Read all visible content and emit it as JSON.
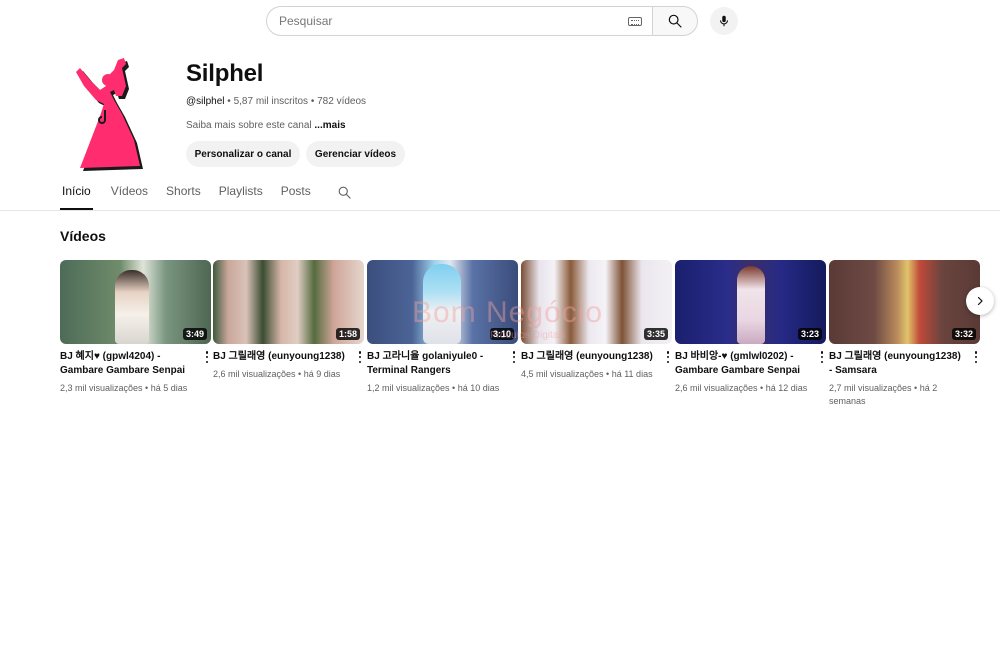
{
  "search": {
    "placeholder": "Pesquisar"
  },
  "channel": {
    "name": "Silphel",
    "handle": "@silphel",
    "subscribers": "5,87 mil inscritos",
    "video_count": "782 vídeos",
    "description": "Saiba mais sobre este canal",
    "more_label": "...mais",
    "customize_label": "Personalizar o canal",
    "manage_label": "Gerenciar vídeos"
  },
  "tabs": [
    {
      "label": "Início",
      "active": true
    },
    {
      "label": "Vídeos"
    },
    {
      "label": "Shorts"
    },
    {
      "label": "Playlists"
    },
    {
      "label": "Posts"
    }
  ],
  "section": {
    "title": "Vídeos"
  },
  "videos": [
    {
      "title": "BJ 혜지♥ (gpwl4204) - Gambare Gambare Senpai",
      "views": "2,3 mil visualizações",
      "age": "há 5 dias",
      "duration": "3:49"
    },
    {
      "title": "BJ 그릴래영 (eunyoung1238)",
      "views": "2,6 mil visualizações",
      "age": "há 9 dias",
      "duration": "1:58"
    },
    {
      "title": "BJ 고라니율 golaniyule0 - Terminal Rangers",
      "views": "1,2 mil visualizações",
      "age": "há 10 dias",
      "duration": "3:10"
    },
    {
      "title": "BJ 그릴래영 (eunyoung1238)",
      "views": "4,5 mil visualizações",
      "age": "há 11 dias",
      "duration": "3:35"
    },
    {
      "title": "BJ 바비앙-♥ (gmlwl0202) - Gambare Gambare Senpai",
      "views": "2,6 mil visualizações",
      "age": "há 12 dias",
      "duration": "3:23"
    },
    {
      "title": "BJ 그릴래영 (eunyoung1238) - Samsara",
      "views": "2,7 mil visualizações",
      "age": "há 2 semanas",
      "duration": "3:32"
    }
  ],
  "watermark": {
    "text": "Bom Negócio",
    "sub": "Produtos Digitais"
  },
  "icons": {
    "keyboard": "keyboard-icon",
    "search": "search-icon",
    "mic": "mic-icon",
    "tab_search": "search-icon",
    "more": "kebab-icon",
    "next": "chevron-right-icon"
  },
  "colors": {
    "avatar_pink": "#ff2d6f",
    "avatar_shadow": "#1a1a1a"
  }
}
